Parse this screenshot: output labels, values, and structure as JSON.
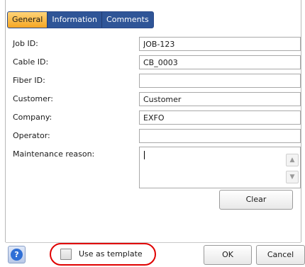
{
  "tabs": [
    {
      "label": "General"
    },
    {
      "label": "Information"
    },
    {
      "label": "Comments"
    }
  ],
  "fields": {
    "job_id": {
      "label": "Job ID:",
      "value": "JOB-123"
    },
    "cable_id": {
      "label": "Cable ID:",
      "value": "CB_0003"
    },
    "fiber_id": {
      "label": "Fiber ID:",
      "value": ""
    },
    "customer": {
      "label": "Customer:",
      "value": "Customer"
    },
    "company": {
      "label": "Company:",
      "value": "EXFO"
    },
    "operator": {
      "label": "Operator:",
      "value": ""
    },
    "maintenance_reason": {
      "label": "Maintenance reason:",
      "value": ""
    }
  },
  "buttons": {
    "clear": "Clear",
    "ok": "OK",
    "cancel": "Cancel",
    "help": "?"
  },
  "template": {
    "label": "Use as template",
    "checked": false
  },
  "icons": {
    "help": "help-icon",
    "scroll_up": "chevron-up-icon",
    "scroll_down": "chevron-down-icon"
  },
  "colors": {
    "active_tab": "#f5a623",
    "tab_bar": "#2f5597",
    "highlight": "#e00000"
  }
}
